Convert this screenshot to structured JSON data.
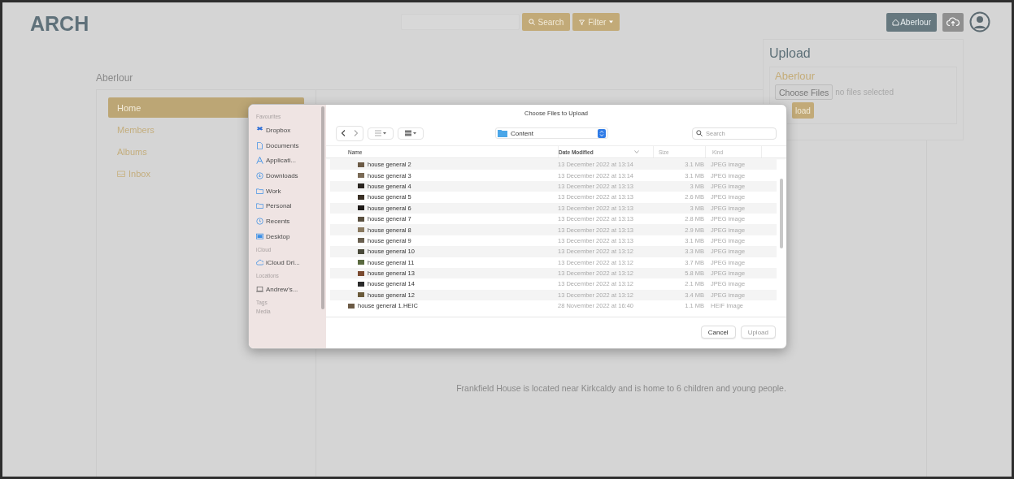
{
  "header": {
    "logo": "ARCH",
    "search_button": "Search",
    "filter_button": "Filter",
    "house_button": "Aberlour"
  },
  "page_title": "Aberlour",
  "nav": [
    {
      "label": "Home",
      "selected": true,
      "kind": "plain"
    },
    {
      "label": "Members",
      "selected": false,
      "kind": "plain"
    },
    {
      "label": "Albums",
      "selected": false,
      "kind": "plain"
    },
    {
      "label": "Inbox",
      "selected": false,
      "kind": "inbox"
    }
  ],
  "description": "Frankfield House is located near Kirkcaldy and is home to 6 children and young people.",
  "upload_panel": {
    "title": "Upload",
    "house": "Aberlour",
    "choose_button": "Choose Files",
    "file_status": "no files selected",
    "upload_button": "load"
  },
  "dialog": {
    "title": "Choose Files to Upload",
    "location": "Content",
    "search_placeholder": "Search",
    "sidebar": [
      {
        "heading": "Favourites",
        "items": [
          "Dropbox",
          "Documents",
          "Applicati...",
          "Downloads",
          "Work",
          "Personal",
          "Recents",
          "Desktop"
        ]
      },
      {
        "heading": "iCloud",
        "items": [
          "iCloud Dri..."
        ]
      },
      {
        "heading": "Locations",
        "items": [
          "Andrew's..."
        ]
      },
      {
        "heading": "Tags"
      },
      {
        "heading": "Media"
      }
    ],
    "columns": [
      {
        "label": "Name",
        "sorted": false
      },
      {
        "label": "Date Modified",
        "sorted": true
      },
      {
        "label": "Size",
        "sorted": false
      },
      {
        "label": "Kind",
        "sorted": false
      }
    ],
    "rows": [
      {
        "children": [
          {
            "name": "house general 2",
            "date": "13 December 2022 at 13:14",
            "size": "3.1 MB",
            "kind": "JPEG image"
          },
          {
            "name": "house general 3",
            "date": "13 December 2022 at 13:14",
            "size": "3.1 MB",
            "kind": "JPEG image"
          },
          {
            "name": "house general 4",
            "date": "13 December 2022 at 13:13",
            "size": "3 MB",
            "kind": "JPEG image"
          },
          {
            "name": "house general 5",
            "date": "13 December 2022 at 13:13",
            "size": "2.6 MB",
            "kind": "JPEG image"
          },
          {
            "name": "house general 6",
            "date": "13 December 2022 at 13:13",
            "size": "3 MB",
            "kind": "JPEG image"
          },
          {
            "name": "house general 7",
            "date": "13 December 2022 at 13:13",
            "size": "2.8 MB",
            "kind": "JPEG image"
          },
          {
            "name": "house general 8",
            "date": "13 December 2022 at 13:13",
            "size": "2.9 MB",
            "kind": "JPEG image"
          },
          {
            "name": "house general 9",
            "date": "13 December 2022 at 13:13",
            "size": "3.1 MB",
            "kind": "JPEG image"
          },
          {
            "name": "house general 10",
            "date": "13 December 2022 at 13:12",
            "size": "3.3 MB",
            "kind": "JPEG image"
          },
          {
            "name": "house general 11",
            "date": "13 December 2022 at 13:12",
            "size": "3.7 MB",
            "kind": "JPEG image"
          },
          {
            "name": "house general 13",
            "date": "13 December 2022 at 13:12",
            "size": "5.8 MB",
            "kind": "JPEG image"
          },
          {
            "name": "house general 14",
            "date": "13 December 2022 at 13:12",
            "size": "2.1 MB",
            "kind": "JPEG image"
          },
          {
            "name": "house general 12",
            "date": "13 December 2022 at 13:12",
            "size": "3.4 MB",
            "kind": "JPEG image"
          }
        ]
      },
      {
        "name": "house general 1.HEIC",
        "date": "28 November 2022 at 16:40",
        "size": "1.1 MB",
        "kind": "HEIF Image"
      }
    ],
    "buttons": [
      {
        "label": "Cancel",
        "disabled": false
      },
      {
        "label": "Upload",
        "disabled": true
      }
    ]
  }
}
